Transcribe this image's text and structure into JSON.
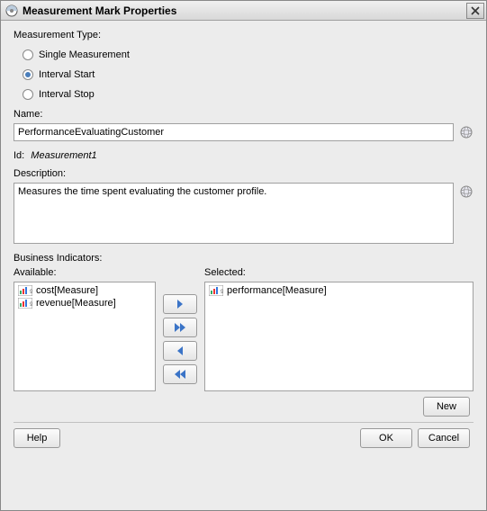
{
  "window": {
    "title": "Measurement Mark Properties"
  },
  "measurementType": {
    "label": "Measurement Type:",
    "options": [
      {
        "label": "Single Measurement",
        "selected": false
      },
      {
        "label": "Interval Start",
        "selected": true
      },
      {
        "label": "Interval Stop",
        "selected": false
      }
    ]
  },
  "name": {
    "label": "Name:",
    "value": "PerformanceEvaluatingCustomer"
  },
  "id": {
    "label": "Id:",
    "value": "Measurement1"
  },
  "description": {
    "label": "Description:",
    "value": "Measures the time spent evaluating the customer profile."
  },
  "businessIndicators": {
    "label": "Business Indicators:",
    "availableLabel": "Available:",
    "selectedLabel": "Selected:",
    "available": [
      {
        "label": "cost[Measure]"
      },
      {
        "label": "revenue[Measure]"
      }
    ],
    "selected": [
      {
        "label": "performance[Measure]"
      }
    ]
  },
  "buttons": {
    "new": "New",
    "help": "Help",
    "ok": "OK",
    "cancel": "Cancel"
  }
}
